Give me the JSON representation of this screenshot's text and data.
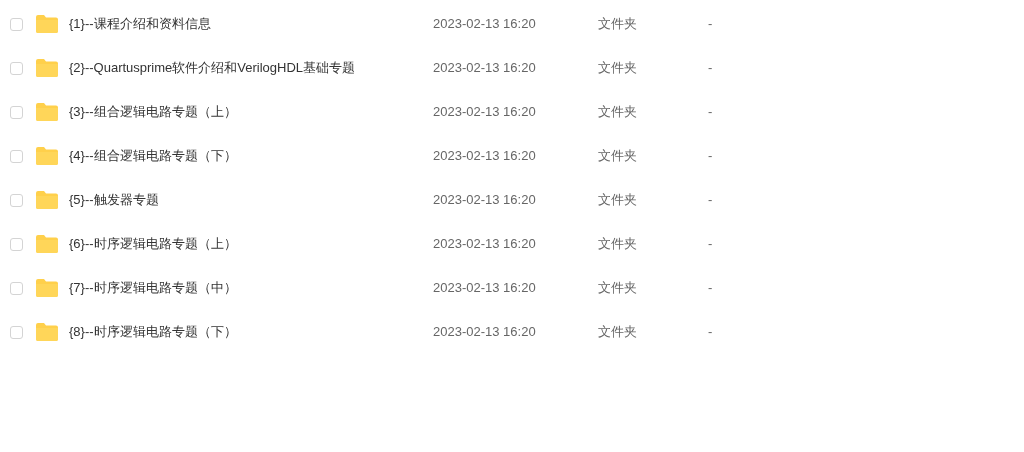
{
  "files": [
    {
      "name": "{1}--课程介绍和资料信息",
      "modified": "2023-02-13 16:20",
      "type": "文件夹",
      "filesize": "-",
      "checked": false
    },
    {
      "name": "{2}--Quartusprime软件介绍和VerilogHDL基础专题",
      "modified": "2023-02-13 16:20",
      "type": "文件夹",
      "filesize": "-",
      "checked": false
    },
    {
      "name": "{3}--组合逻辑电路专题（上）",
      "modified": "2023-02-13 16:20",
      "type": "文件夹",
      "filesize": "-",
      "checked": false
    },
    {
      "name": "{4}--组合逻辑电路专题（下）",
      "modified": "2023-02-13 16:20",
      "type": "文件夹",
      "filesize": "-",
      "checked": false
    },
    {
      "name": "{5}--触发器专题",
      "modified": "2023-02-13 16:20",
      "type": "文件夹",
      "filesize": "-",
      "checked": false
    },
    {
      "name": "{6}--时序逻辑电路专题（上）",
      "modified": "2023-02-13 16:20",
      "type": "文件夹",
      "filesize": "-",
      "checked": false
    },
    {
      "name": "{7}--时序逻辑电路专题（中）",
      "modified": "2023-02-13 16:20",
      "type": "文件夹",
      "filesize": "-",
      "checked": false
    },
    {
      "name": "{8}--时序逻辑电路专题（下）",
      "modified": "2023-02-13 16:20",
      "type": "文件夹",
      "filesize": "-",
      "checked": false
    }
  ]
}
